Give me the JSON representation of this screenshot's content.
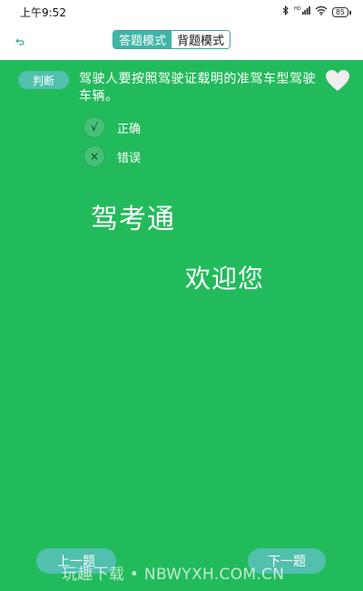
{
  "status_bar": {
    "time": "上午9:52",
    "network": "HD",
    "battery": "85"
  },
  "nav": {
    "modes": [
      {
        "label": "答题模式",
        "active": true
      },
      {
        "label": "背题模式",
        "active": false
      }
    ]
  },
  "question": {
    "type_label": "判断",
    "text": "驾驶人要按照驾驶证载明的准驾车型驾驶车辆。",
    "options": [
      {
        "symbol": "√",
        "label": "正确"
      },
      {
        "symbol": "×",
        "label": "错误"
      }
    ],
    "favorited": false
  },
  "welcome": {
    "line1": "驾考通",
    "line2": "欢迎您"
  },
  "footer": {
    "prev_label": "上一题",
    "next_label": "下一题"
  },
  "watermark": "玩趣下载 • NBWYXH.COM.CN",
  "colors": {
    "background": "#22bb5c",
    "accent": "#51c0ad",
    "mode_border": "#3aa79a",
    "option_circle": "#44c077"
  },
  "icons": {
    "back": "back-arrow-icon",
    "favorite": "heart-icon",
    "bluetooth": "bluetooth-icon",
    "signal": "signal-icon",
    "wifi": "wifi-icon",
    "battery": "battery-icon"
  }
}
